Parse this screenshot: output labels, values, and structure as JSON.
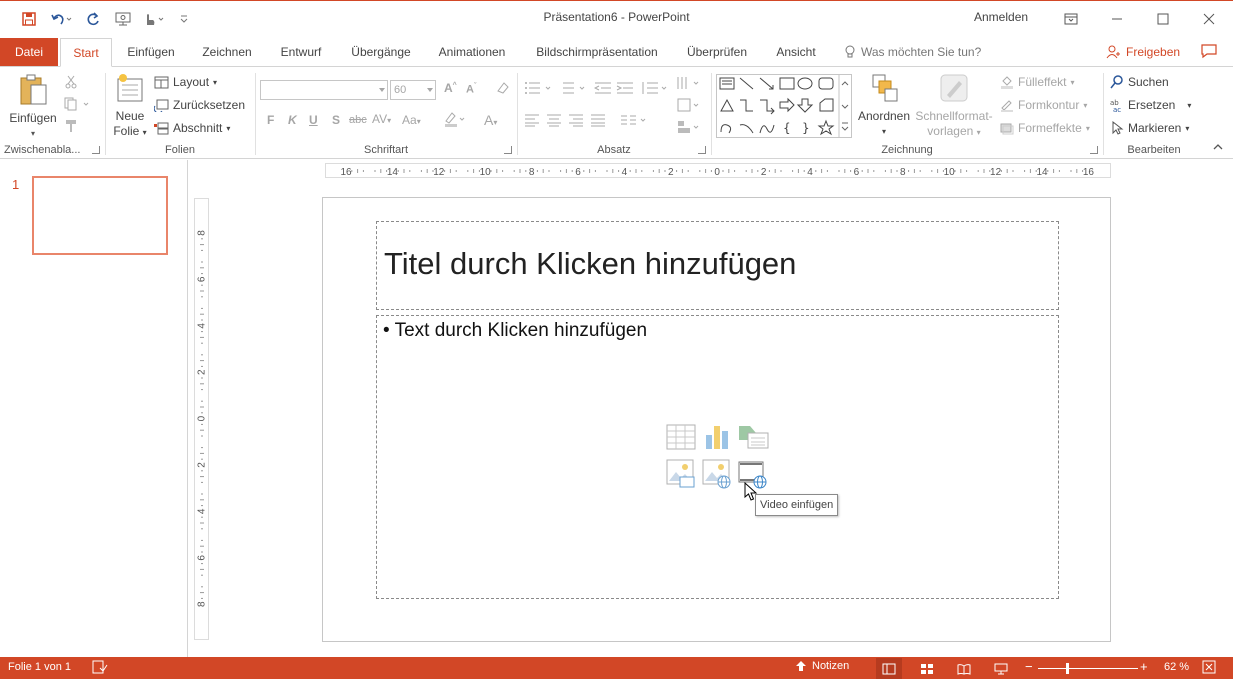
{
  "window": {
    "title": "Präsentation6  -  PowerPoint",
    "signin": "Anmelden"
  },
  "tabs": {
    "file": "Datei",
    "items": [
      "Start",
      "Einfügen",
      "Zeichnen",
      "Entwurf",
      "Übergänge",
      "Animationen",
      "Bildschirmpräsentation",
      "Überprüfen",
      "Ansicht"
    ],
    "active_index": 0,
    "tellme": "Was möchten Sie tun?",
    "share": "Freigeben"
  },
  "ribbon": {
    "clipboard": {
      "label": "Zwischenabla...",
      "paste": "Einfügen"
    },
    "slides": {
      "label": "Folien",
      "new_slide_1": "Neue",
      "new_slide_2": "Folie",
      "layout": "Layout",
      "reset": "Zurücksetzen",
      "section": "Abschnitt"
    },
    "font": {
      "label": "Schriftart",
      "font_name": "",
      "font_size": "60",
      "bold": "F",
      "italic": "K",
      "underline": "U",
      "shadow": "S",
      "strike": "abc"
    },
    "paragraph": {
      "label": "Absatz"
    },
    "drawing": {
      "label": "Zeichnung",
      "arrange": "Anordnen",
      "quick_styles_1": "Schnellformat-",
      "quick_styles_2": "vorlagen",
      "fill": "Fülleffekt",
      "outline": "Formkontur",
      "effects": "Formeffekte"
    },
    "editing": {
      "label": "Bearbeiten",
      "find": "Suchen",
      "replace": "Ersetzen",
      "select": "Markieren"
    }
  },
  "thumbnails": {
    "slide_number": "1"
  },
  "ruler": {
    "horizontal": [
      "16",
      "14",
      "12",
      "10",
      "8",
      "6",
      "4",
      "2",
      "0",
      "2",
      "4",
      "6",
      "8",
      "10",
      "12",
      "14",
      "16"
    ],
    "vertical": [
      "8",
      "6",
      "4",
      "2",
      "0",
      "2",
      "4",
      "6",
      "8"
    ]
  },
  "slide": {
    "title_placeholder": "Titel durch Klicken hinzufügen",
    "body_bullet": "•",
    "body_placeholder": "Text durch Klicken hinzufügen",
    "tooltip": "Video einfügen"
  },
  "status": {
    "slide_info": "Folie 1 von 1",
    "notes": "Notizen",
    "zoom": "62 %"
  },
  "colors": {
    "accent": "#d24726",
    "accent_dark": "#b63b1f"
  }
}
